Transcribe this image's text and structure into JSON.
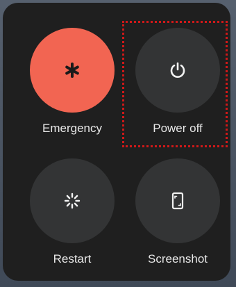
{
  "power_menu": {
    "items": [
      {
        "id": "emergency",
        "label": "Emergency",
        "icon": "asterisk-icon",
        "color": "#f26552"
      },
      {
        "id": "power_off",
        "label": "Power off",
        "icon": "power-icon",
        "color": "#333435"
      },
      {
        "id": "restart",
        "label": "Restart",
        "icon": "restart-icon",
        "color": "#333435"
      },
      {
        "id": "screenshot",
        "label": "Screenshot",
        "icon": "screenshot-icon",
        "color": "#333435"
      }
    ],
    "highlight_color": "#d01818",
    "highlighted_item": "power_off"
  }
}
